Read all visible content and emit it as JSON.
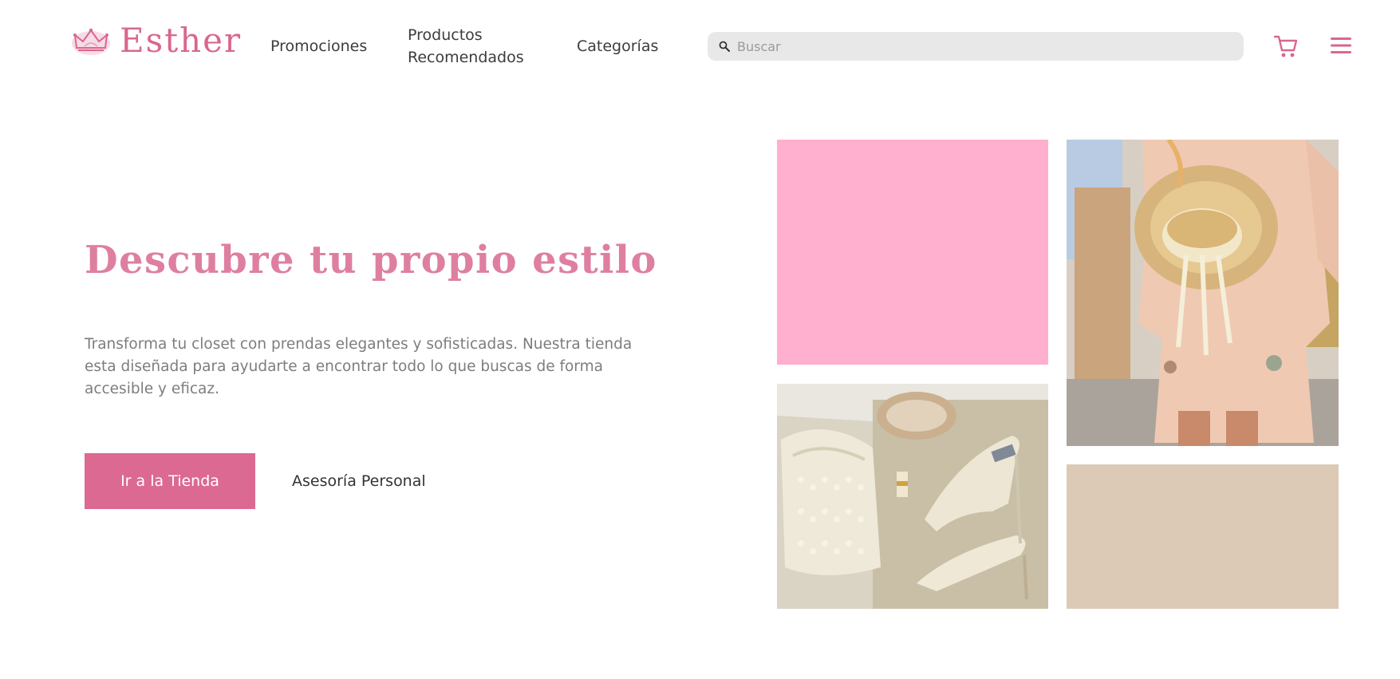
{
  "header": {
    "brand": "Esther",
    "nav": {
      "promociones": "Promociones",
      "productos_line1": "Productos",
      "productos_line2": "Recomendados",
      "categorias": "Categorías"
    },
    "search": {
      "placeholder": "Buscar",
      "icon": "search-icon"
    },
    "cart_icon": "cart-icon",
    "menu_icon": "hamburger-menu-icon"
  },
  "hero": {
    "title": "Descubre tu propio estilo",
    "description": "Transforma tu closet con prendas elegantes y sofisticadas. Nuestra tienda esta diseñada para ayudarte a encontrar todo lo que buscas de forma accesible y eficaz.",
    "primary_button": "Ir a la Tienda",
    "secondary_button": "Asesoría Personal"
  },
  "gallery": {
    "tiles": [
      "pink-color-block",
      "woman-with-straw-hat-photo",
      "shoes-and-pearl-bag-photo",
      "beige-color-block"
    ]
  },
  "colors": {
    "brand_pink": "#d9678f",
    "title_pink": "#de7fa1",
    "button_pink": "#dc6991",
    "block_pink": "#ffb0ce",
    "block_beige": "#dccab7",
    "search_bg": "#e8e8e8"
  }
}
